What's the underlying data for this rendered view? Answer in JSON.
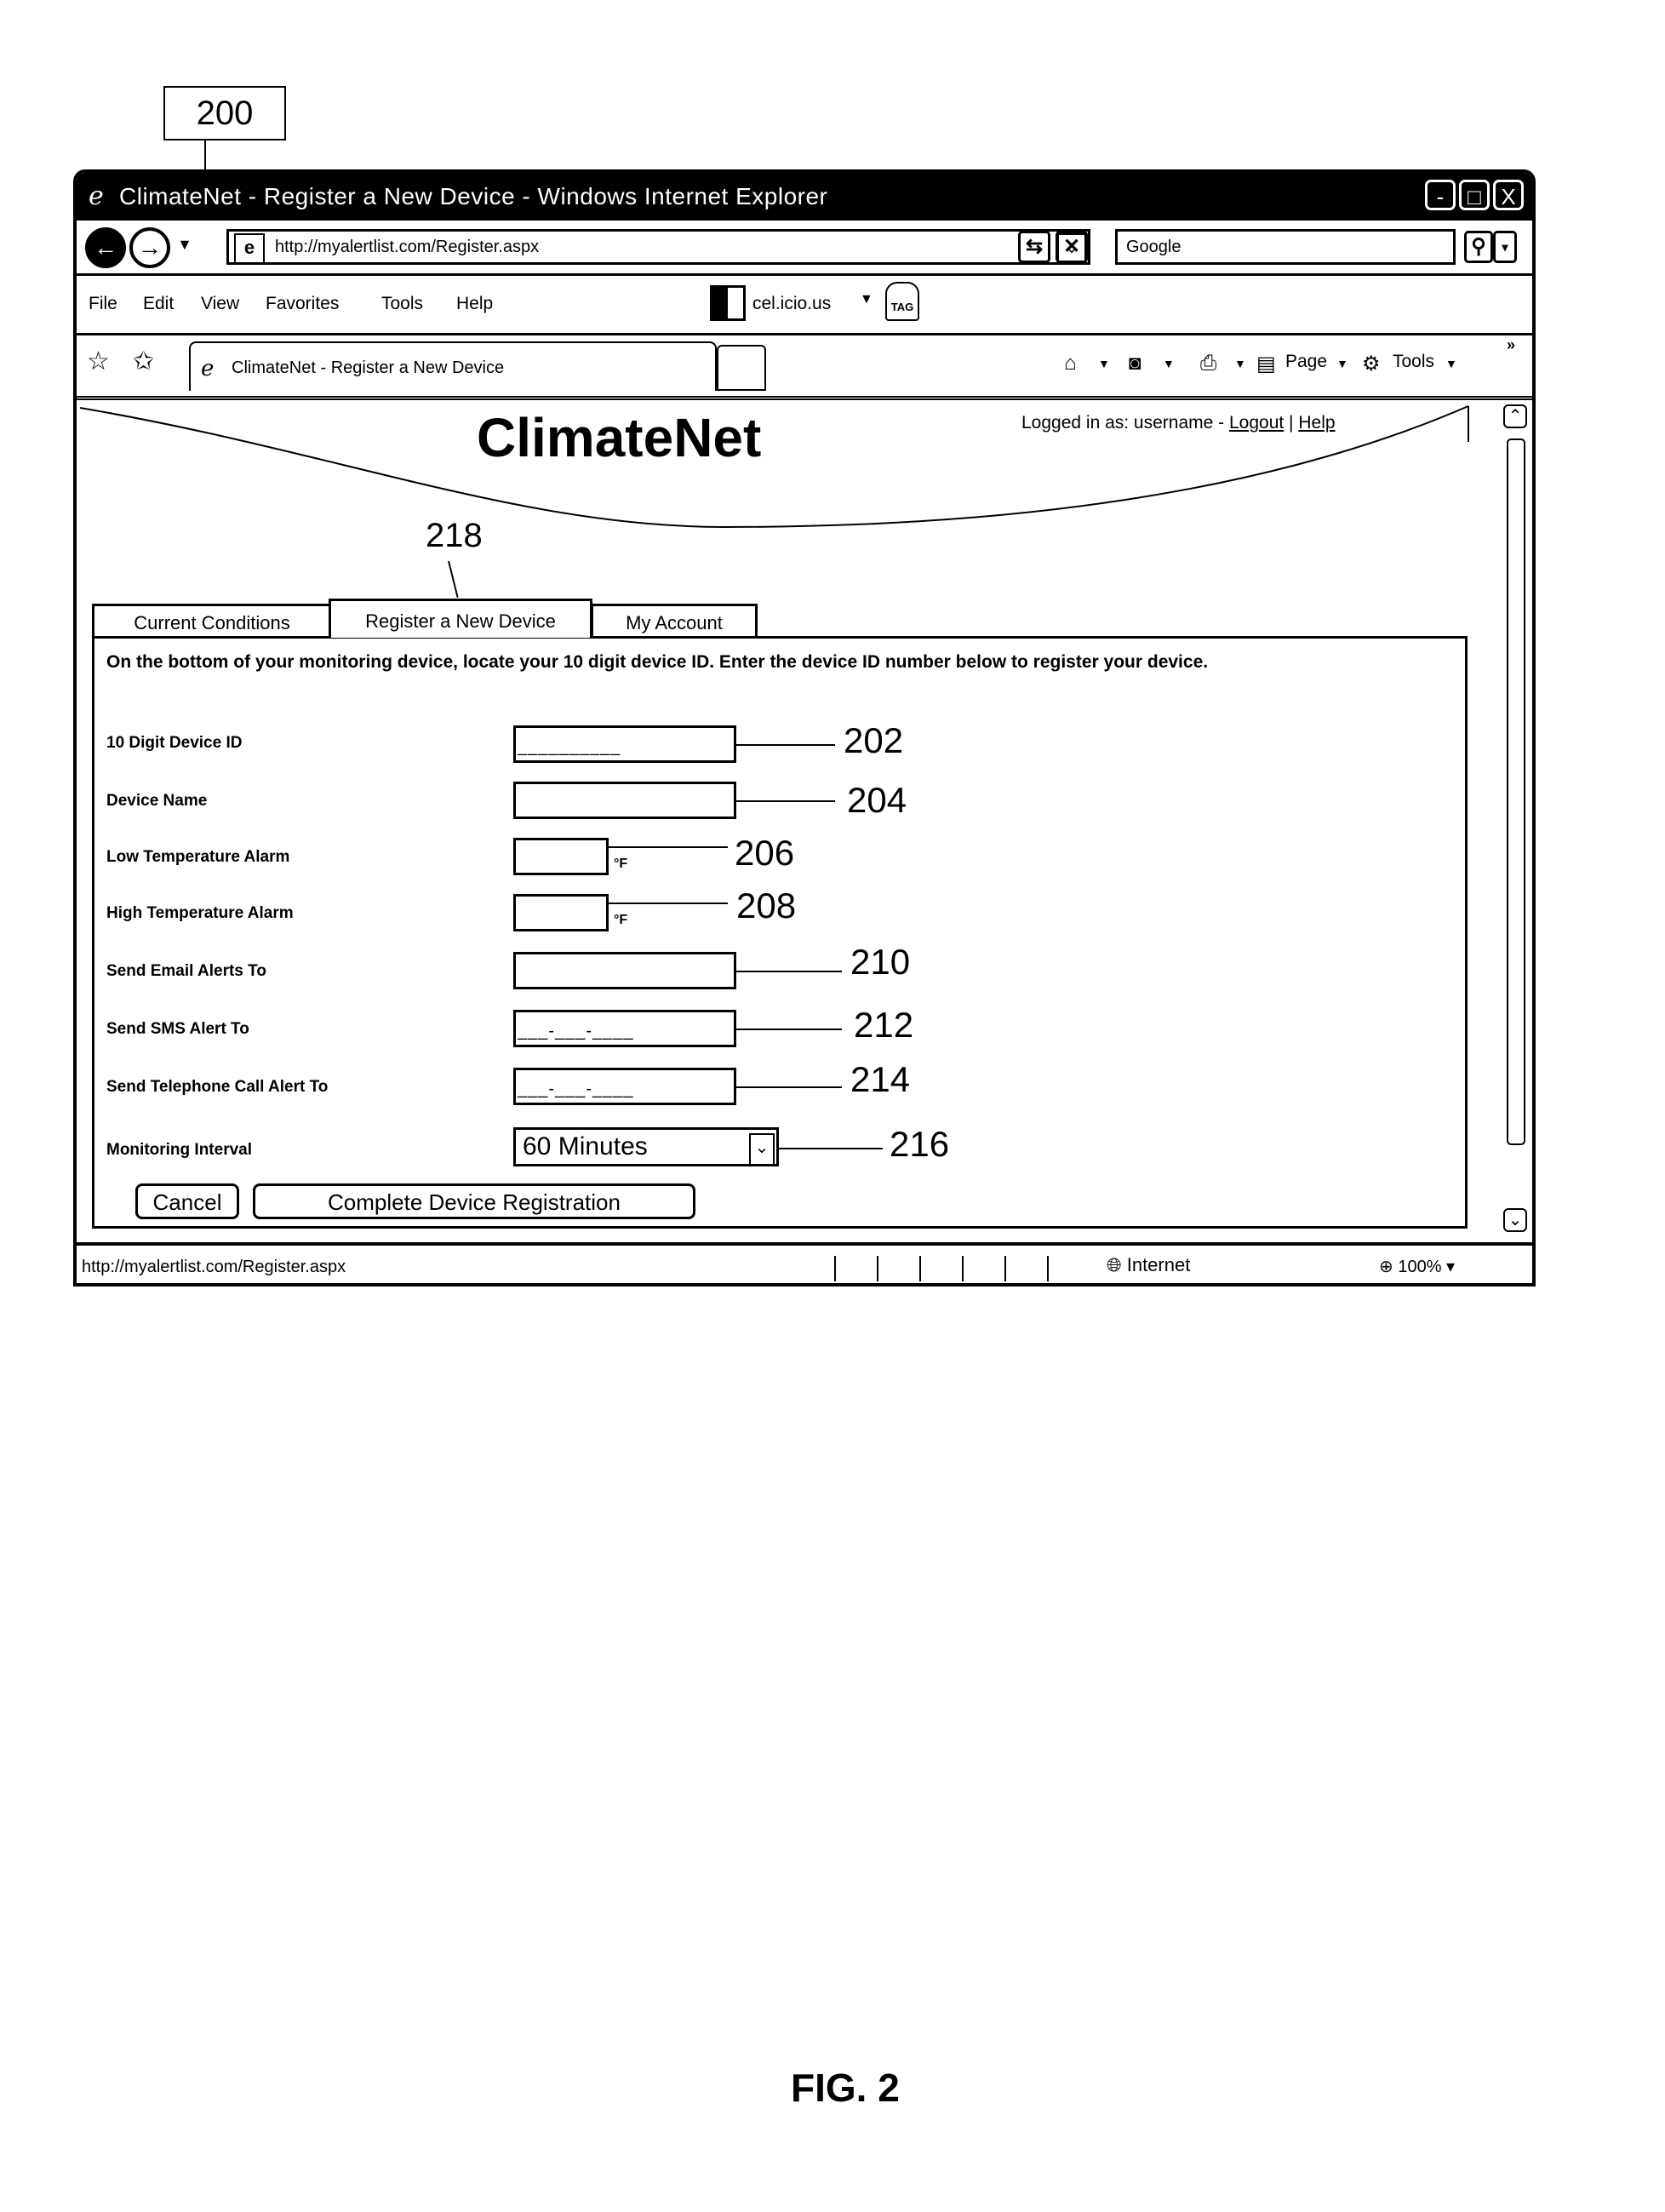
{
  "figure": {
    "reference_label": "200",
    "caption": "FIG. 2",
    "tab_reference": "218"
  },
  "browser": {
    "window_title": "ClimateNet - Register a New Device - Windows Internet Explorer",
    "window_controls": {
      "minimize": "-",
      "maximize": "□",
      "close": "X"
    },
    "address": "http://myalertlist.com/Register.aspx",
    "search_placeholder": "Google",
    "menu": [
      "File",
      "Edit",
      "View",
      "Favorites",
      "Tools",
      "Help"
    ],
    "toolbar_extension": "cel.icio.us",
    "tag_label": "TAG",
    "tab_title": "ClimateNet - Register a New Device",
    "command_bar": {
      "page": "Page",
      "tools": "Tools"
    },
    "status_url": "http://myalertlist.com/Register.aspx",
    "status_zone": "Internet",
    "status_zoom": "100%"
  },
  "site": {
    "brand": "ClimateNet",
    "logged_in_prefix": "Logged in as: username - ",
    "logout": "Logout",
    "separator": " | ",
    "help": "Help",
    "tabs": [
      {
        "label": "Current Conditions",
        "active": false
      },
      {
        "label": "Register a New Device",
        "active": true
      },
      {
        "label": "My Account",
        "active": false
      }
    ],
    "intro": "On the bottom of your monitoring device, locate your 10 digit device ID. Enter the device ID number below to register your device."
  },
  "form": {
    "fields": [
      {
        "label": "10 Digit Device ID",
        "value": "",
        "mask": "__________",
        "ref": "202",
        "unit": ""
      },
      {
        "label": "Device Name",
        "value": "",
        "mask": "",
        "ref": "204",
        "unit": ""
      },
      {
        "label": "Low Temperature Alarm",
        "value": "",
        "mask": "",
        "ref": "206",
        "unit": "°F"
      },
      {
        "label": "High Temperature Alarm",
        "value": "",
        "mask": "",
        "ref": "208",
        "unit": "°F"
      },
      {
        "label": "Send Email Alerts To",
        "value": "",
        "mask": "",
        "ref": "210",
        "unit": ""
      },
      {
        "label": "Send SMS Alert To",
        "value": "",
        "mask": "___-___-____",
        "ref": "212",
        "unit": ""
      },
      {
        "label": "Send Telephone Call Alert To",
        "value": "",
        "mask": "___-___-____",
        "ref": "214",
        "unit": ""
      }
    ],
    "interval": {
      "label": "Monitoring Interval",
      "selected": "60 Minutes",
      "ref": "216"
    },
    "cancel_label": "Cancel",
    "submit_label": "Complete Device Registration"
  }
}
